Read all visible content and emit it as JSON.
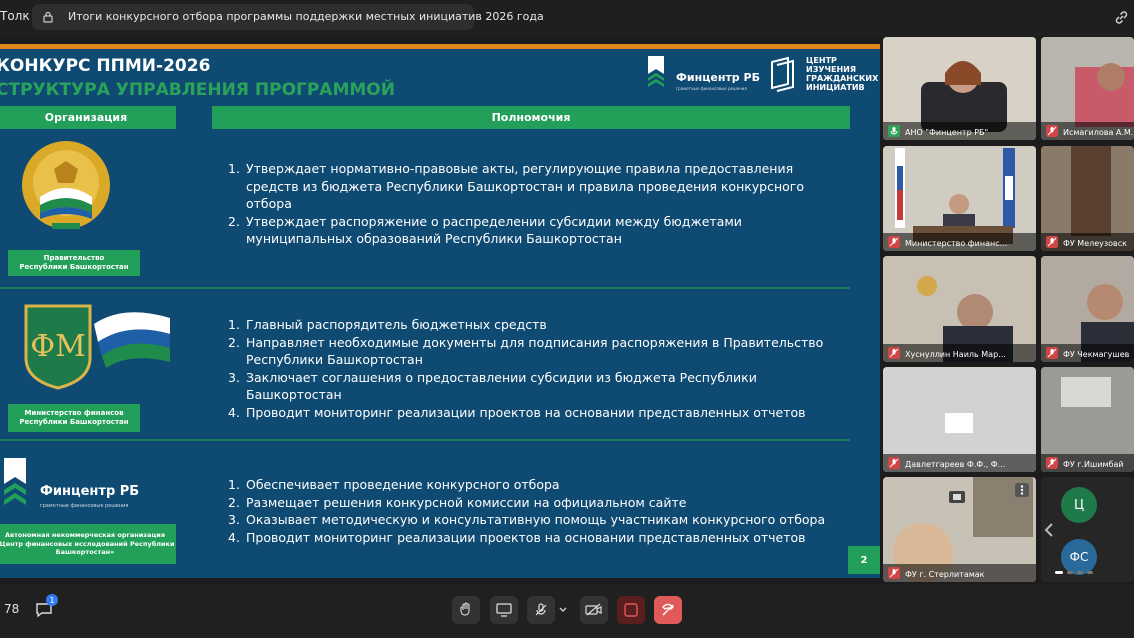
{
  "top_bar": {
    "app_label": "Толк",
    "tab_title": "Итоги конкурсного отбора программы поддержки местных инициатив 2026 года"
  },
  "slide": {
    "title_line1": "КОНКУРС ППМИ-2026",
    "title_line2": "СТРУКТУРА УПРАВЛЕНИЯ ПРОГРАММОЙ",
    "header_left": "Организация",
    "header_right": "Полномочия",
    "logo_fincenter": {
      "name": "Финцентр РБ",
      "tagline": "грамотные финансовые решения"
    },
    "logo_center": [
      "ЦЕНТР",
      "ИЗУЧЕНИЯ",
      "ГРАЖДАНСКИХ",
      "ИНИЦИАТИВ"
    ],
    "rows": [
      {
        "org_line1": "Правительство",
        "org_line2": "Республики Башкортостан",
        "items": [
          {
            "num": "1.",
            "text": "Утверждает нормативно-правовые акты, регулирующие правила предоставления средств из бюджета Республики Башкортостан и правила проведения конкурсного отбора"
          },
          {
            "num": "2.",
            "text": "Утверждает распоряжение о распределении субсидии между бюджетами муниципальных образований Республики Башкортостан"
          }
        ]
      },
      {
        "org_line1": "Министерство финансов",
        "org_line2": "Республики Башкортостан",
        "items": [
          {
            "num": "1.",
            "text": "Главный распорядитель бюджетных средств"
          },
          {
            "num": "2.",
            "text": "Направляет необходимые документы для подписания распоряжения в Правительство Республики Башкортостан"
          },
          {
            "num": "3.",
            "text": "Заключает соглашения о предоставлении субсидии из бюджета Республики Башкортостан"
          },
          {
            "num": "4.",
            "text": "Проводит мониторинг реализации проектов на основании представленных отчетов"
          }
        ]
      },
      {
        "org_logo_name": "Финцентр РБ",
        "org_logo_tagline": "грамотные финансовые решения",
        "org_line1": "Автономная некоммерческая организация",
        "org_line2": "«Центр финансовых исследований Республики",
        "org_line3": "Башкортостан»",
        "items": [
          {
            "num": "1.",
            "text": "Обеспечивает проведение конкурсного отбора"
          },
          {
            "num": "2.",
            "text": "Размещает решения конкурсной комиссии на официальном сайте"
          },
          {
            "num": "3.",
            "text": "Оказывает методическую и консультативную помощь участникам конкурсного отбора"
          },
          {
            "num": "4.",
            "text": "Проводит мониторинг реализации проектов на основании представленных отчетов"
          }
        ]
      }
    ],
    "page_number": "2"
  },
  "participants": [
    {
      "name": "АНО \"Финцентр РБ\"",
      "muted": false
    },
    {
      "name": "Исмагилова А.М.",
      "muted": true
    },
    {
      "name": "Министерство финанс...",
      "muted": true
    },
    {
      "name": "ФУ Мелеузовск",
      "muted": true
    },
    {
      "name": "Хуснуллин Наиль Мар...",
      "muted": true
    },
    {
      "name": "ФУ Чекмагушев",
      "muted": true
    },
    {
      "name": "Давлетгареев Ф.Ф., Ф...",
      "muted": true
    },
    {
      "name": "ФУ г.Ишимбай",
      "muted": true
    },
    {
      "name": "ФУ г. Стерлитамак",
      "muted": true
    },
    {
      "name": "Ц",
      "muted": false
    },
    {
      "name": "ФС",
      "muted": false
    }
  ],
  "bottom_bar": {
    "participant_count": "78",
    "chat_badge": "1"
  },
  "colors": {
    "slide_bg": "#0f4a73",
    "accent_green": "#22a05a",
    "orange_strip": "#e0861e",
    "end_call": "#e05a5a",
    "active_speaker": "#2e7df2"
  }
}
